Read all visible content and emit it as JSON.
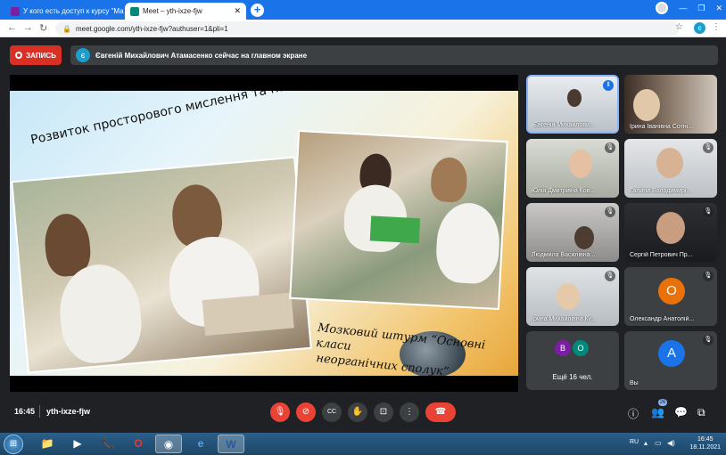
{
  "tabs": [
    {
      "title": "У кого есть доступ к курсу \"Ма",
      "icon": "classroom-icon",
      "color": "#7b1fa2"
    },
    {
      "title": "Meet – yth-ixze-fjw",
      "icon": "meet-icon",
      "color": "#00897b"
    }
  ],
  "address": {
    "url": "meet.google.com/yth-ixze-fjw?authuser=1&pli=1",
    "profile": "є"
  },
  "record": {
    "label": "ЗАПИСЬ"
  },
  "presenting": {
    "avatar": "є",
    "text": "Євгеній Михайлович Атамасенко сейчас на главном экране"
  },
  "slide": {
    "title1": "Розвиток просторового мислення та пам’яті.",
    "title2_line1": "Мозковий штурм “Основні класи",
    "title2_line2": "неорганічних сполук”"
  },
  "participants": [
    {
      "name": "Євгеній Михайлови...",
      "speaking": true
    },
    {
      "name": "Ірина Іванівна Сотні..."
    },
    {
      "name": "Юлія Дмитрівна Ков...",
      "muted": true
    },
    {
      "name": "Галина Володимирі...",
      "muted": true
    },
    {
      "name": "Людмила Василівна...",
      "muted": true
    },
    {
      "name": "Сергій Петрович Пр...",
      "muted": true
    },
    {
      "name": "Ірина Михайлівна Ку...",
      "muted": true
    },
    {
      "name": "Олександр Анатолій...",
      "avatar": "О",
      "color": "#e8710a",
      "muted": true
    },
    {
      "more": "Ещё 16 чел.",
      "avatars": [
        "В",
        "О"
      ]
    },
    {
      "name": "Вы",
      "avatar": "А",
      "color": "#1a73e8",
      "muted": true
    }
  ],
  "controls": {
    "time": "16:45",
    "code": "yth-ixze-fjw",
    "participants_count": "26"
  },
  "taskbar": {
    "lang": "RU",
    "time": "16:45",
    "date": "18.11.2021"
  }
}
